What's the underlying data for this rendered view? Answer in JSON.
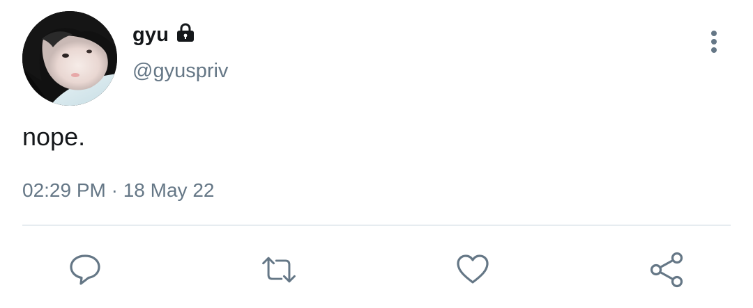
{
  "tweet": {
    "author": {
      "display_name": "gyu",
      "handle": "@gyuspriv",
      "protected_icon": "lock-icon",
      "avatar": "profile-photo"
    },
    "text": "nope.",
    "timestamp": "02:29 PM · 18 May 22"
  },
  "menu_icon": "more-vertical-icon",
  "actions": [
    {
      "name": "reply",
      "icon": "reply-icon"
    },
    {
      "name": "retweet",
      "icon": "retweet-icon"
    },
    {
      "name": "like",
      "icon": "heart-icon"
    },
    {
      "name": "share",
      "icon": "share-icon"
    }
  ],
  "colors": {
    "text_primary": "#14171a",
    "text_secondary": "#657786",
    "icon_gray": "#657786",
    "divider": "#e6ecf0",
    "background": "#ffffff"
  }
}
